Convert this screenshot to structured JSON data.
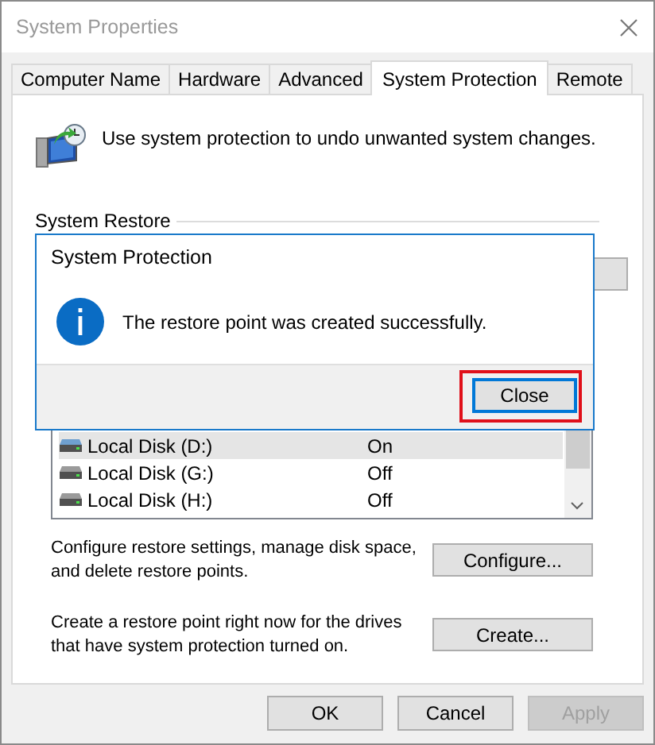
{
  "window": {
    "title": "System Properties"
  },
  "tabs": [
    {
      "label": "Computer Name",
      "selected": false
    },
    {
      "label": "Hardware",
      "selected": false
    },
    {
      "label": "Advanced",
      "selected": false
    },
    {
      "label": "System Protection",
      "selected": true
    },
    {
      "label": "Remote",
      "selected": false
    }
  ],
  "intro": "Use system protection to undo unwanted system changes.",
  "system_restore": {
    "label": "System Restore"
  },
  "drives": [
    {
      "name": "Local Disk (D:)",
      "protection": "On",
      "selected": true
    },
    {
      "name": "Local Disk (G:)",
      "protection": "Off",
      "selected": false
    },
    {
      "name": "Local Disk (H:)",
      "protection": "Off",
      "selected": false
    }
  ],
  "configure": {
    "text": "Configure restore settings, manage disk space, and delete restore points.",
    "button": "Configure..."
  },
  "create": {
    "text": "Create a restore point right now for the drives that have system protection turned on.",
    "button": "Create..."
  },
  "buttons": [
    {
      "label": "OK",
      "disabled": false
    },
    {
      "label": "Cancel",
      "disabled": false
    },
    {
      "label": "Apply",
      "disabled": true
    }
  ],
  "dialog": {
    "title": "System Protection",
    "message": "The restore point was created successfully.",
    "button": {
      "label": "Close",
      "focused": true,
      "highlighted": true
    }
  }
}
